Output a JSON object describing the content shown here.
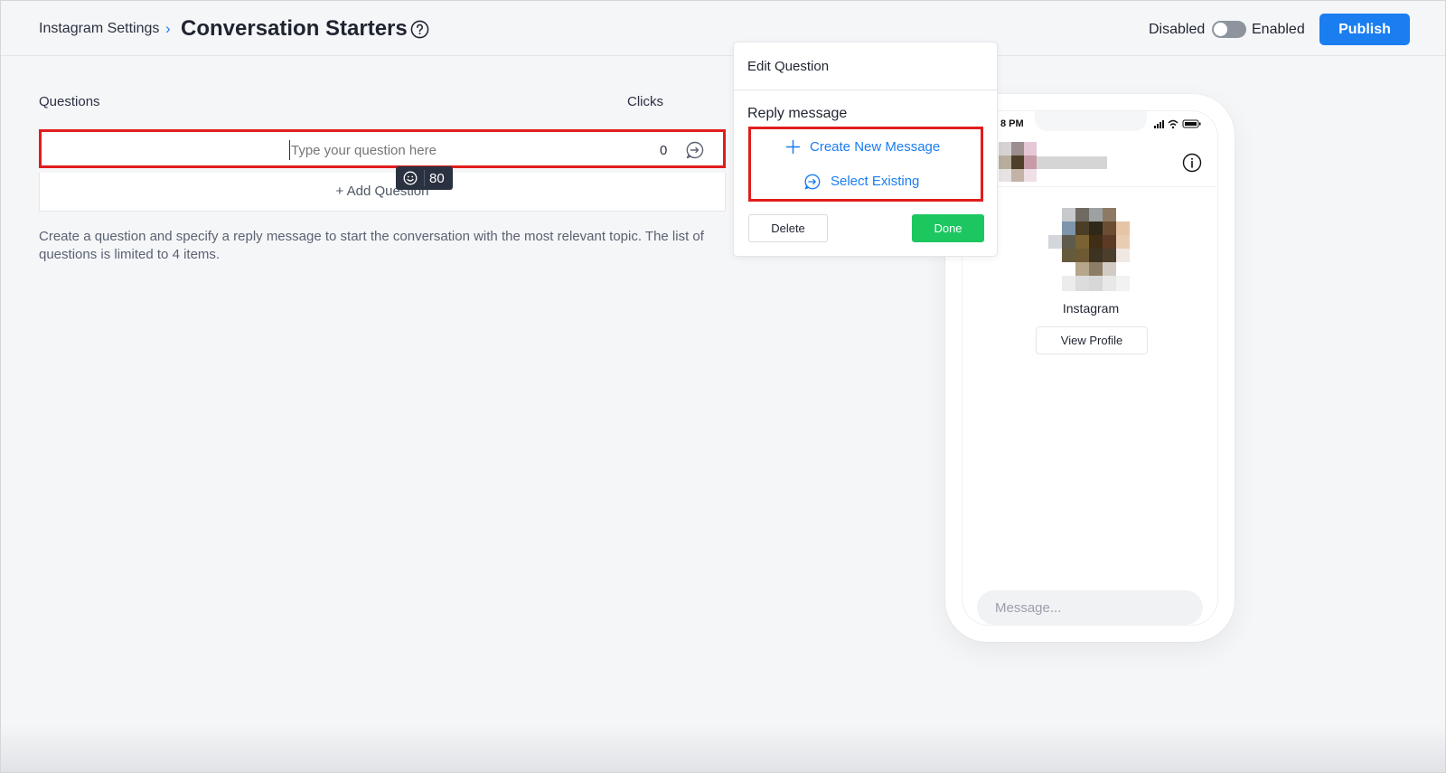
{
  "header": {
    "breadcrumb": "Instagram Settings",
    "breadcrumb_sep": "›",
    "title": "Conversation Starters",
    "toggle_off_label": "Disabled",
    "toggle_on_label": "Enabled",
    "toggle_state": "off",
    "publish_label": "Publish"
  },
  "questions": {
    "col_questions": "Questions",
    "col_clicks": "Clicks",
    "rows": [
      {
        "placeholder": "Type your question here",
        "value": "",
        "clicks": "0"
      }
    ],
    "char_counter": "80",
    "add_label": "+ Add Question",
    "hint": "Create a question and specify a reply message to start the conversation with the most relevant topic. The list of questions is limited to 4 items."
  },
  "popup": {
    "title": "Edit Question",
    "reply_label": "Reply message",
    "create_label": "Create New Message",
    "select_label": "Select Existing",
    "delete_label": "Delete",
    "done_label": "Done"
  },
  "preview": {
    "time": "8 PM",
    "profile_name": "Instagram",
    "view_profile_label": "View Profile",
    "message_placeholder": "Message..."
  },
  "colors": {
    "accent": "#1a7df0",
    "done": "#1cc760",
    "highlight": "#e11d1d",
    "tooltip": "#2a3140"
  },
  "icons": [
    "help-circle-icon",
    "chat-reply-icon",
    "smile-icon",
    "plus-icon",
    "info-icon",
    "signal-icon",
    "wifi-icon",
    "battery-icon"
  ]
}
